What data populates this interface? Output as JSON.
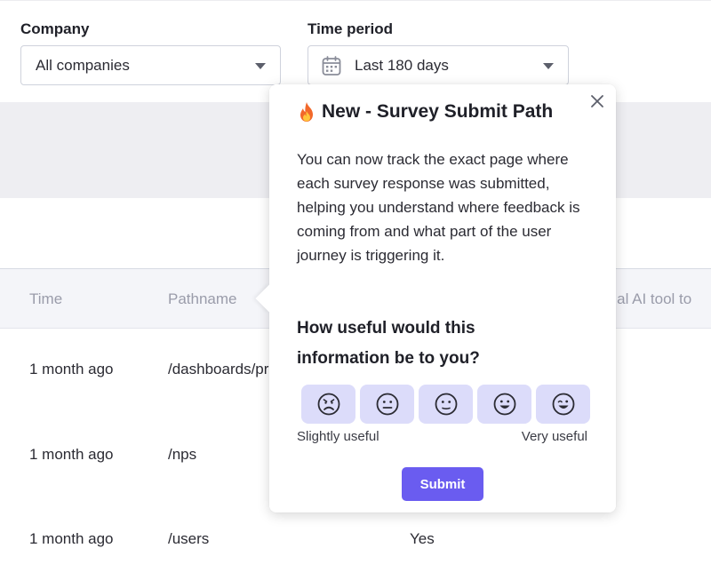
{
  "filters": {
    "company_label": "Company",
    "company_value": "All companies",
    "period_label": "Time period",
    "period_value": "Last 180 days",
    "period_icon": "calendar-icon"
  },
  "table": {
    "headers": [
      "Time",
      "Pathname",
      "rnal AI tool to"
    ],
    "rows": [
      {
        "time": "1 month ago",
        "pathname": "/dashboards/pr",
        "answer": ""
      },
      {
        "time": "1 month ago",
        "pathname": "/nps",
        "answer": ""
      },
      {
        "time": "1 month ago",
        "pathname": "/users",
        "answer": "Yes"
      }
    ]
  },
  "popover": {
    "title_icon": "fire-icon",
    "title": "New - Survey Submit Path",
    "body": "You can now track the exact page where each survey response was submitted, helping you understand where feedback is coming from and what part of the user journey is triggering it.",
    "question": "How useful would this information be to you?",
    "rating_options": [
      "very-sad-face-icon",
      "neutral-face-icon",
      "meh-face-icon",
      "smile-face-icon",
      "wink-face-icon"
    ],
    "scale_min_label": "Slightly useful",
    "scale_max_label": "Very useful",
    "submit_label": "Submit",
    "close_icon": "close-icon"
  },
  "colors": {
    "accent": "#6a5cf0",
    "face_bg": "#dcdcfa",
    "band_gray": "#eeeef2",
    "table_header_bg": "#f4f5f9"
  }
}
